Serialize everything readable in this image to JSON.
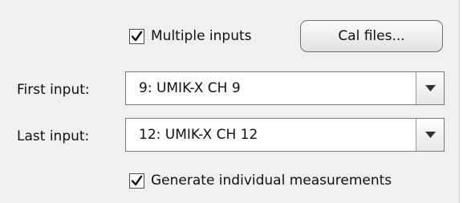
{
  "multiple_inputs": {
    "label": "Multiple inputs",
    "checked": true
  },
  "cal_files_button": {
    "label": "Cal files..."
  },
  "first_input": {
    "label": "First input:",
    "value": "9: UMIK-X CH 9"
  },
  "last_input": {
    "label": "Last input:",
    "value": "12: UMIK-X CH 12"
  },
  "generate_individual": {
    "label": "Generate individual measurements",
    "checked": true
  },
  "icons": {
    "checkbox": "check-icon",
    "dropdown": "triangle-down-icon"
  }
}
